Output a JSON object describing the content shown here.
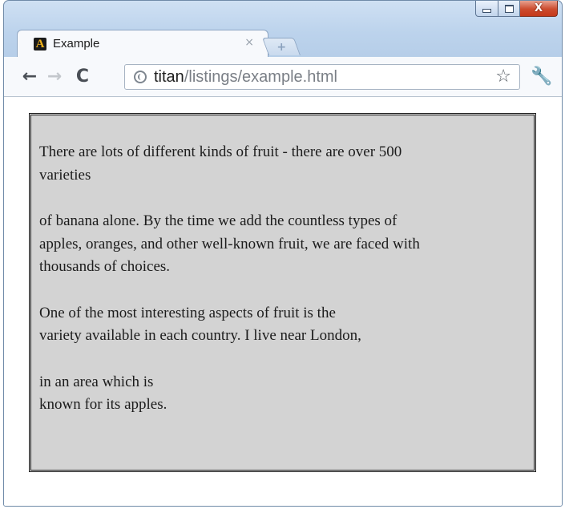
{
  "window": {
    "caption_buttons": {
      "minimize_icon": "minimize-icon",
      "maximize_icon": "maximize-icon",
      "close_label": "X"
    }
  },
  "tab": {
    "title": "Example",
    "close_glyph": "×",
    "favicon_letter": "A"
  },
  "new_tab": {
    "icon": "plus-icon"
  },
  "toolbar": {
    "back_glyph": "←",
    "forward_glyph": "→",
    "reload_glyph": "C",
    "url_host": "titan",
    "url_path": "/listings/example.html",
    "star_glyph": "☆",
    "wrench_glyph": "🔧"
  },
  "content": {
    "lines": [
      "There are lots of different kinds of fruit - there are over 500",
      "varieties",
      "of banana alone. By the time we add the countless types of",
      "apples, oranges, and other well-known fruit, we are faced with",
      "thousands of choices.",
      "One of the most interesting aspects of fruit is the",
      "variety available in each country. I live near London,",
      "in an area which is",
      "known for its apples."
    ]
  },
  "colors": {
    "content_background": "#d3d3d3",
    "content_border": "#222222",
    "frame": "#bcd3ec",
    "close_button": "#cc4b2e"
  }
}
